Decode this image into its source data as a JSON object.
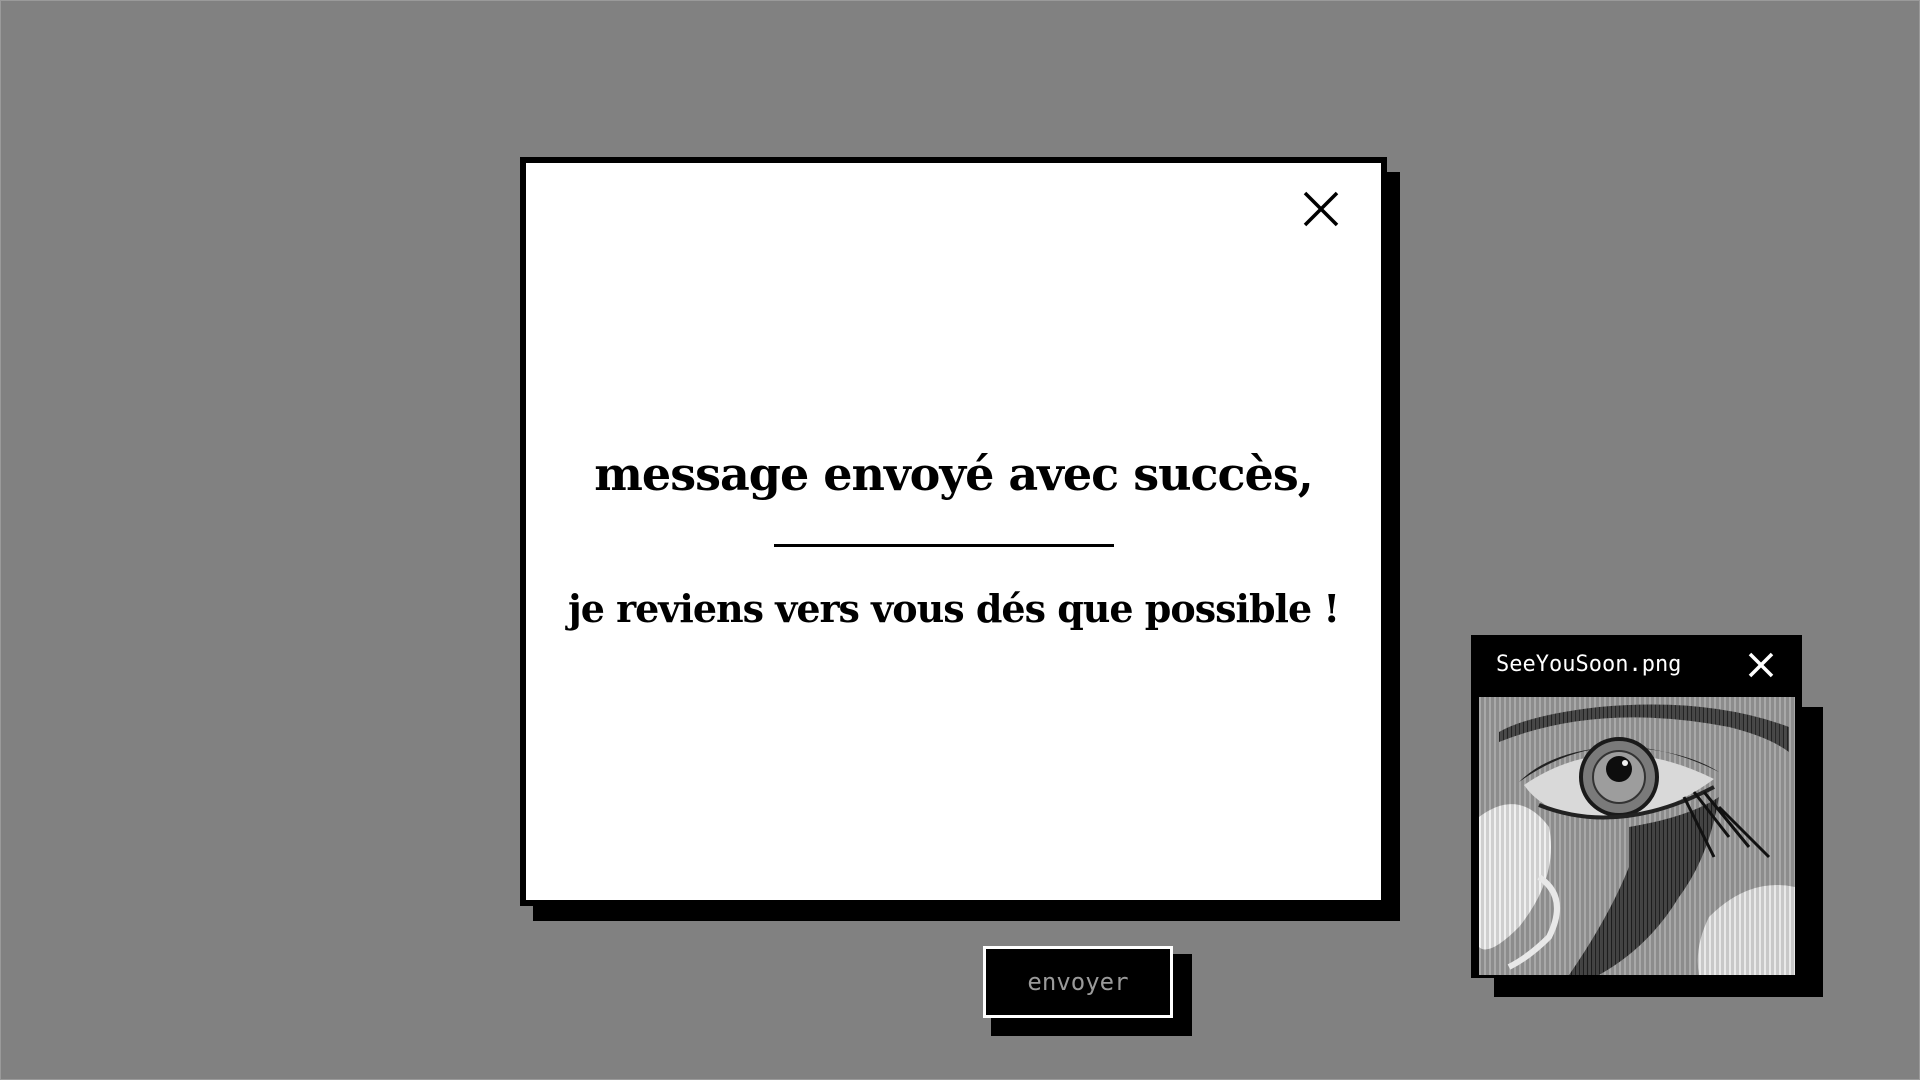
{
  "dialog": {
    "title": "message envoyé avec succès,",
    "message": "je reviens vers vous dés que possible !",
    "close_icon": "close-icon"
  },
  "send_button": {
    "label": "envoyer"
  },
  "image_window": {
    "title": "SeeYouSoon.png",
    "close_icon": "close-icon",
    "image_subject": "eye"
  },
  "colors": {
    "background": "#818181",
    "dialog_bg": "#ffffff",
    "border": "#000000",
    "button_text": "#9a9a9a",
    "titlebar_text": "#ffffff"
  }
}
